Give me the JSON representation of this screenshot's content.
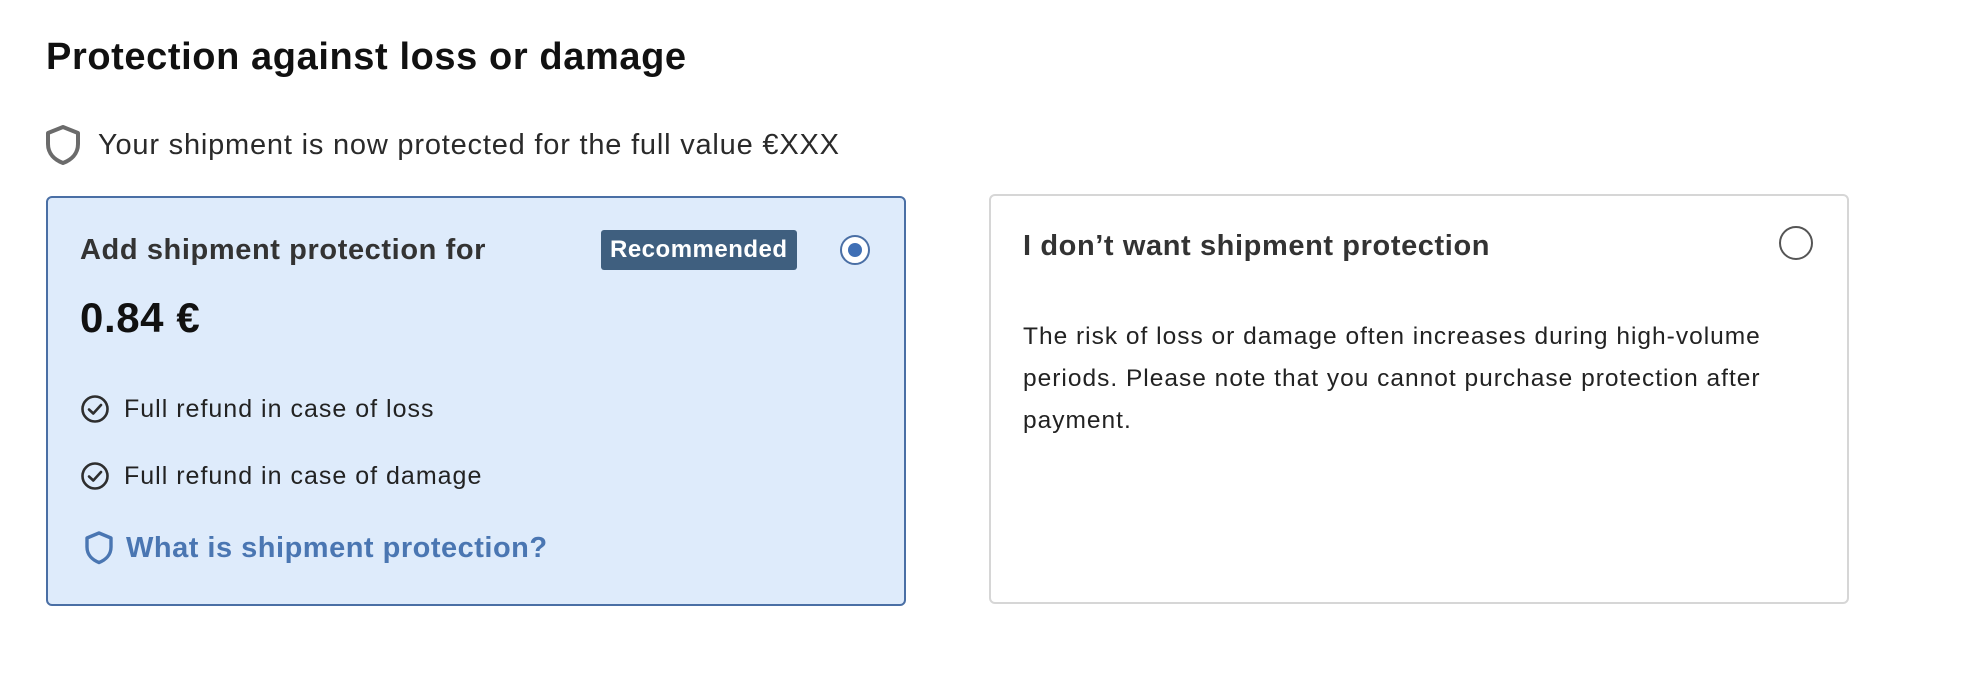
{
  "page": {
    "title": "Protection against loss or damage",
    "status_text": "Your shipment is now protected for the full value €XXX"
  },
  "options": {
    "protection": {
      "heading": "Add shipment protection for",
      "badge": "Recommended",
      "price": "0.84 €",
      "selected": true,
      "features": [
        "Full refund in case of loss",
        "Full refund in case of damage"
      ],
      "link_label": "What is shipment protection?"
    },
    "no_protection": {
      "heading": "I don’t want shipment protection",
      "selected": false,
      "description": "The risk of loss or damage often increases during high-volume periods. Please note that you cannot purchase protection after payment."
    }
  },
  "icons": {
    "status": "shield-icon",
    "feature": "check-circle-icon",
    "link": "shield-icon"
  },
  "colors": {
    "selected_card_bg": "#deebfb",
    "selected_border": "#4a6fa5",
    "badge_bg": "#3f5f7f",
    "link": "#4a76b2",
    "radio_dot": "#3f6fb5"
  }
}
